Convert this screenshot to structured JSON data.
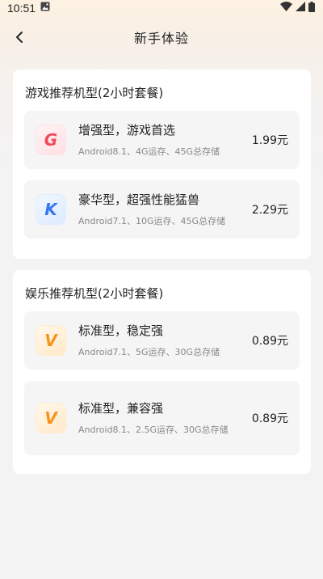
{
  "status": {
    "time": "10:51"
  },
  "nav": {
    "title": "新手体验"
  },
  "sections": [
    {
      "title": "游戏推荐机型(2小时套餐)",
      "items": [
        {
          "name": "增强型，游戏首选",
          "spec": "Android8.1、4G运存、45G总存储",
          "price": "1.99元",
          "logo": "G",
          "logo_color": "#f0505e"
        },
        {
          "name": "豪华型，超强性能猛兽",
          "spec": "Android7.1、10G运存、45G总存储",
          "price": "2.29元",
          "logo": "K",
          "logo_color": "#3d7bf5"
        }
      ]
    },
    {
      "title": "娱乐推荐机型(2小时套餐)",
      "items": [
        {
          "name": "标准型，稳定强",
          "spec": "Android7.1、5G运存、30G总存储",
          "price": "0.89元",
          "logo": "V",
          "logo_color": "#f7961e"
        },
        {
          "name": "标准型，兼容强",
          "spec": "Android8.1、2.5G运存、30G总存储",
          "price": "0.89元",
          "logo": "V",
          "logo_color": "#f7961e"
        }
      ]
    }
  ]
}
